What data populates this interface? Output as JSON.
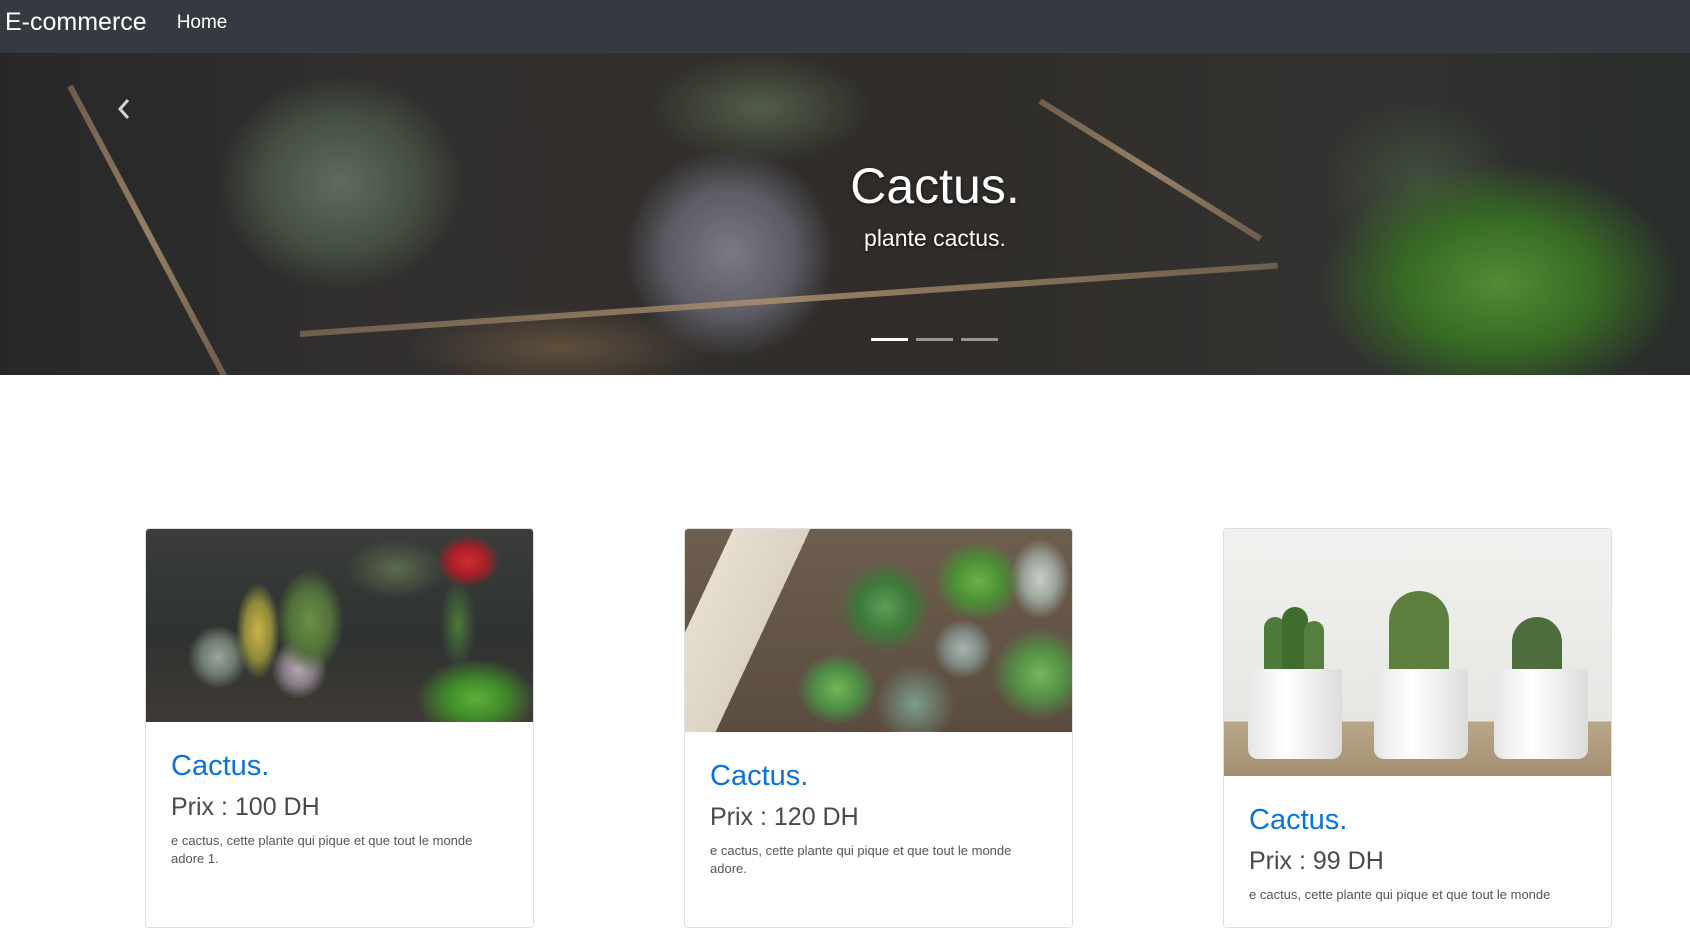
{
  "navbar": {
    "brand": "E-commerce",
    "links": [
      {
        "label": "Home"
      }
    ]
  },
  "carousel": {
    "title": "Cactus.",
    "subtitle": "plante cactus.",
    "indicator_count": 3,
    "active_index": 0,
    "prev_icon": "chevron-left-icon"
  },
  "products": [
    {
      "title": "Cactus.",
      "price": "Prix : 100 DH",
      "description": "e cactus, cette plante qui pique et que tout le monde adore 1."
    },
    {
      "title": "Cactus.",
      "price": "Prix : 120 DH",
      "description": "e cactus, cette plante qui pique et que tout le monde adore."
    },
    {
      "title": "Cactus.",
      "price": "Prix : 99 DH",
      "description": "e cactus, cette plante qui pique et que tout le monde"
    }
  ]
}
